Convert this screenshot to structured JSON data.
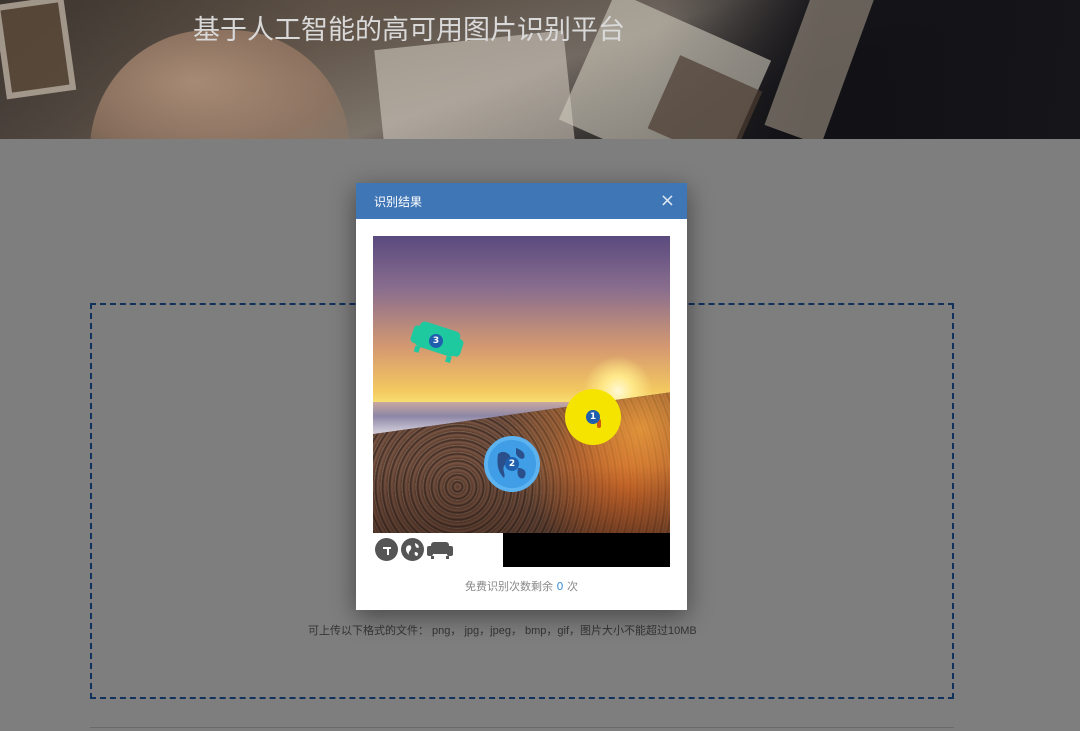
{
  "header": {
    "title": "基于人工智能的高可用图片识别平台"
  },
  "upload": {
    "hint": "可上传以下格式的文件： png， jpg，jpeg， bmp，gif，图片大小不能超过10MB"
  },
  "modal": {
    "title": "识别结果",
    "close_label": "×",
    "markers": [
      {
        "number": "1",
        "color": "#f5e400"
      },
      {
        "number": "2",
        "color": "#3f9ee6"
      },
      {
        "number": "3",
        "color": "#1ec9a0"
      }
    ],
    "thumbnails": [
      "tool-icon",
      "globe-icon",
      "sofa-icon"
    ],
    "quota": {
      "prefix": "免费识别次数剩余",
      "count": "0",
      "suffix": "次"
    }
  }
}
